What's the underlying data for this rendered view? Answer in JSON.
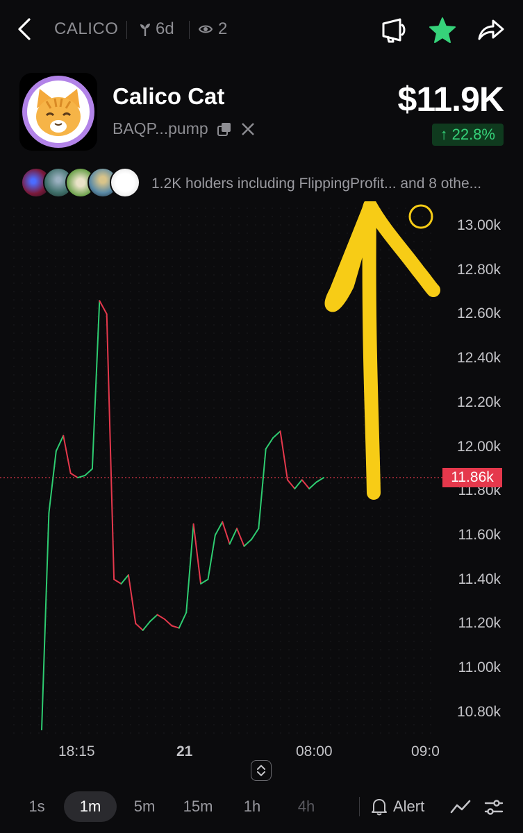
{
  "header": {
    "ticker": "CALICO",
    "age": "6d",
    "watchers": "2"
  },
  "token": {
    "name": "Calico Cat",
    "address": "BAQP...pump",
    "price": "$11.9K",
    "change": "22.8%",
    "change_arrow": "↑"
  },
  "holders": {
    "text": "1.2K holders including FlippingProfit... and 8 othe..."
  },
  "chart_data": {
    "type": "line",
    "y_ticks": [
      "13.00k",
      "12.80k",
      "12.60k",
      "12.40k",
      "12.20k",
      "12.00k",
      "11.80k",
      "11.60k",
      "11.40k",
      "11.20k",
      "11.00k",
      "10.80k"
    ],
    "x_ticks": [
      "18:15",
      "21",
      "08:00",
      "09:0"
    ],
    "current_price_label": "11.86k",
    "current_price": 11.86,
    "series": [
      {
        "values": [
          10.72,
          11.7,
          11.98,
          12.05,
          11.88,
          11.86,
          11.87,
          11.9,
          12.66,
          12.6,
          11.4,
          11.38,
          11.42,
          11.2,
          11.17,
          11.21,
          11.24,
          11.22,
          11.19,
          11.18,
          11.25,
          11.65,
          11.38,
          11.4,
          11.6,
          11.66,
          11.56,
          11.63,
          11.55,
          11.58,
          11.63,
          11.99,
          12.04,
          12.07,
          11.85,
          11.81,
          11.85,
          11.81,
          11.84,
          11.86
        ]
      }
    ],
    "colors": {
      "up": "#2ecc71",
      "down": "#e5384c",
      "grid": "#2a2a2e",
      "annotation": "#f7cc16"
    }
  },
  "intervals": [
    "1s",
    "1m",
    "5m",
    "15m",
    "1h",
    "4h"
  ],
  "active_interval": "1m",
  "alert_label": "Alert"
}
